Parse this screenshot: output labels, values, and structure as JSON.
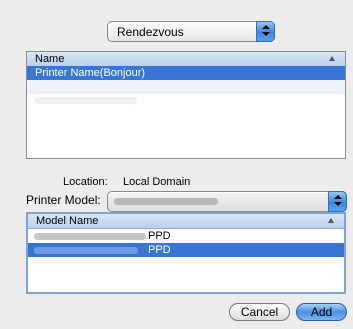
{
  "connection_popup": {
    "value": "Rendezvous"
  },
  "printer_list": {
    "header": "Name",
    "rows": [
      {
        "name": "Printer Name(Bonjour)",
        "selected": true
      }
    ]
  },
  "location": {
    "label": "Location:",
    "value": "Local Domain"
  },
  "printer_model": {
    "label": "Printer Model:"
  },
  "model_list": {
    "header": "Model Name",
    "rows": [
      {
        "suffix": "PPD",
        "selected": false
      },
      {
        "suffix": "PPD",
        "selected": true
      }
    ]
  },
  "buttons": {
    "cancel": "Cancel",
    "add": "Add"
  },
  "colors": {
    "selection": "#3875d7",
    "accent": "#3a86e0"
  }
}
